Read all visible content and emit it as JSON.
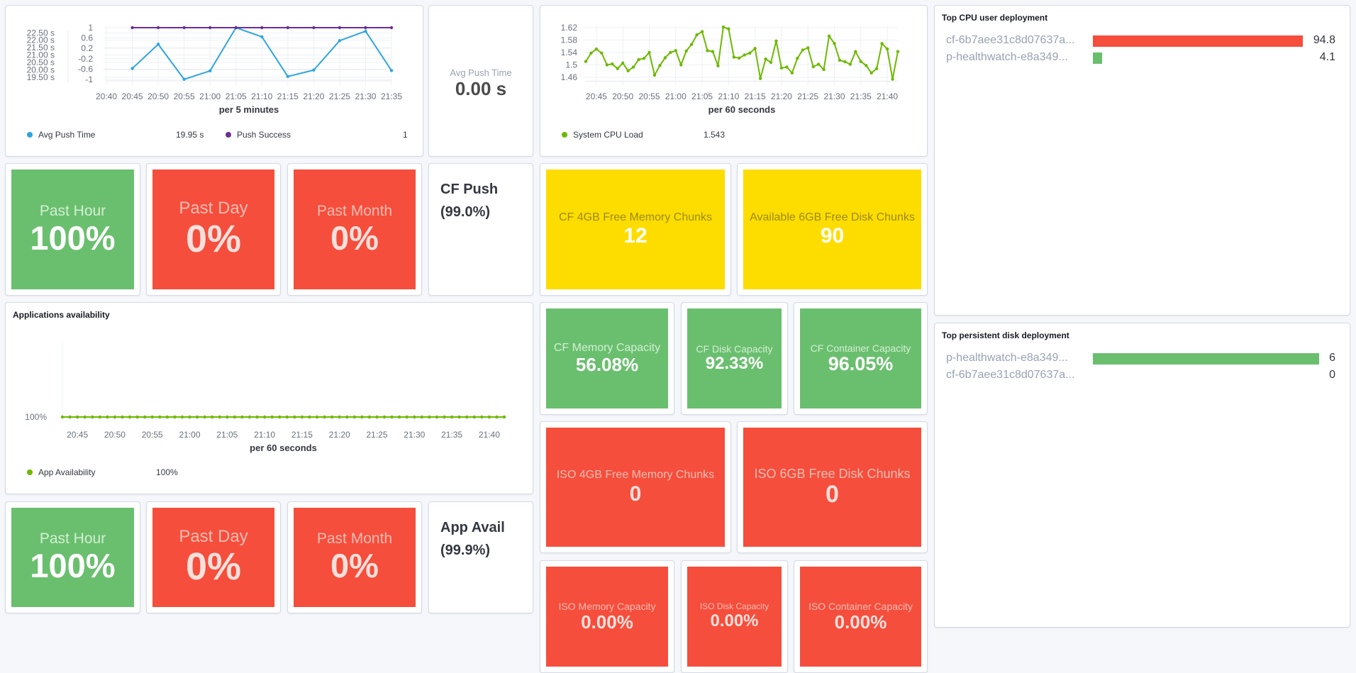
{
  "colors": {
    "green": "#6abf6f",
    "red": "#f54e3c",
    "yellow": "#fddd00",
    "blue": "#2fa4e0",
    "purple": "#6c2e96",
    "lime": "#6db900"
  },
  "push_legend": [
    {
      "label": "Avg Push Time",
      "value": "19.95 s"
    },
    {
      "label": "Push Success",
      "value": "1"
    }
  ],
  "avg_push": {
    "label": "Avg Push Time",
    "value": "0.00 s"
  },
  "cpu_legend": {
    "label": "System CPU Load",
    "value": "1.543"
  },
  "cf_push": {
    "tiles": [
      {
        "label": "Past Hour",
        "value": "100%",
        "status": "green"
      },
      {
        "label": "Past Day",
        "value": "0%",
        "status": "red"
      },
      {
        "label": "Past Month",
        "value": "0%",
        "status": "red"
      }
    ],
    "title": "CF Push",
    "value": "(99.0%)"
  },
  "chunks": [
    {
      "label": "CF 4GB Free Memory Chunks",
      "value": "12",
      "status": "yellow"
    },
    {
      "label": "Available 6GB Free Disk Chunks",
      "value": "90",
      "status": "yellow"
    }
  ],
  "app_availability": {
    "title": "Applications availability",
    "legend_label": "App Availability",
    "legend_value": "100%"
  },
  "cf_capacity": [
    {
      "label": "CF Memory Capacity",
      "value": "56.08%",
      "status": "green"
    },
    {
      "label": "CF Disk Capacity",
      "value": "92.33%",
      "status": "green"
    },
    {
      "label": "CF Container Capacity",
      "value": "96.05%",
      "status": "green"
    }
  ],
  "iso_chunks": [
    {
      "label": "ISO 4GB Free Memory Chunks",
      "value": "0",
      "status": "red"
    },
    {
      "label": "ISO 6GB Free Disk Chunks",
      "value": "0",
      "status": "red"
    }
  ],
  "iso_capacity": [
    {
      "label": "ISO Memory Capacity",
      "value": "0.00%",
      "status": "red"
    },
    {
      "label": "ISO Disk Capacity",
      "value": "0.00%",
      "status": "red"
    },
    {
      "label": "ISO Container Capacity",
      "value": "0.00%",
      "status": "red"
    }
  ],
  "app_avail": {
    "tiles": [
      {
        "label": "Past Hour",
        "value": "100%",
        "status": "green"
      },
      {
        "label": "Past Day",
        "value": "0%",
        "status": "red"
      },
      {
        "label": "Past Month",
        "value": "0%",
        "status": "red"
      }
    ],
    "title": "App Avail",
    "value": "(99.9%)"
  },
  "chart_data": [
    {
      "type": "line",
      "xlabel": "per 5 minutes",
      "x_range": [
        "20:40",
        "21:35"
      ],
      "x_ticks": [
        "20:40",
        "20:45",
        "20:50",
        "20:55",
        "21:00",
        "21:05",
        "21:10",
        "21:15",
        "21:20",
        "21:25",
        "21:30",
        "21:35"
      ],
      "grid": true,
      "y_axes": {
        "left": {
          "ticks": [
            22.5,
            22.0,
            21.5,
            21.0,
            20.5,
            20.0,
            19.5
          ],
          "tick_labels": [
            "22.50 s",
            "22.00 s",
            "21.50 s",
            "21.00 s",
            "20.50 s",
            "20.00 s",
            "19.50 s"
          ],
          "ylim": [
            19.35,
            22.85
          ]
        },
        "right": {
          "ticks": [
            1,
            0.6,
            0.2,
            -0.2,
            -0.6,
            -1
          ],
          "tick_labels": [
            "1",
            "0.6",
            "0.2",
            "-0.2",
            "-0.6",
            "-1"
          ],
          "ylim": [
            -1,
            1
          ]
        }
      },
      "x": [
        "20:45",
        "20:50",
        "20:55",
        "21:00",
        "21:05",
        "21:10",
        "21:15",
        "21:20",
        "21:25",
        "21:30",
        "21:35"
      ],
      "series": [
        {
          "name": "Avg Push Time",
          "axis": "left",
          "color": "#2fa4e0",
          "values": [
            20.09,
            21.73,
            19.36,
            19.93,
            22.85,
            22.23,
            19.55,
            19.98,
            21.97,
            22.61,
            19.95
          ]
        },
        {
          "name": "Push Success",
          "axis": "right",
          "color": "#6c2e96",
          "values": [
            1,
            1,
            1,
            1,
            1,
            1,
            1,
            1,
            1,
            1,
            1
          ]
        }
      ],
      "legend": "bottom"
    },
    {
      "type": "line",
      "xlabel": "per 60 seconds",
      "x_range": [
        "20:43",
        "21:42"
      ],
      "x_ticks": [
        "20:45",
        "20:50",
        "20:55",
        "21:00",
        "21:05",
        "21:10",
        "21:15",
        "21:20",
        "21:25",
        "21:30",
        "21:35",
        "21:40"
      ],
      "grid": true,
      "y_axes": {
        "left": {
          "ticks": [
            1.62,
            1.58,
            1.54,
            1.5,
            1.46
          ],
          "tick_labels": [
            "1.62",
            "1.58",
            "1.54",
            "1.5",
            "1.46"
          ],
          "ylim": [
            1.452,
            1.628
          ]
        }
      },
      "x_start": "20:43",
      "x_step_minutes": 1,
      "series": [
        {
          "name": "System CPU Load",
          "axis": "left",
          "color": "#6db900",
          "values": [
            1.511,
            1.538,
            1.551,
            1.538,
            1.5,
            1.503,
            1.488,
            1.506,
            1.481,
            1.493,
            1.517,
            1.521,
            1.54,
            1.467,
            1.498,
            1.523,
            1.54,
            1.546,
            1.5,
            1.545,
            1.566,
            1.597,
            1.607,
            1.546,
            1.543,
            1.497,
            1.622,
            1.616,
            1.525,
            1.522,
            1.532,
            1.538,
            1.553,
            1.456,
            1.519,
            1.508,
            1.577,
            1.49,
            1.493,
            1.474,
            1.521,
            1.548,
            1.555,
            1.494,
            1.502,
            1.485,
            1.593,
            1.569,
            1.515,
            1.51,
            1.502,
            1.543,
            1.511,
            1.498,
            1.474,
            1.488,
            1.569,
            1.551,
            1.454,
            1.543
          ]
        }
      ],
      "legend": "bottom"
    },
    {
      "type": "line",
      "xlabel": "per 60 seconds",
      "x_range": [
        "20:43",
        "21:42"
      ],
      "x_ticks": [
        "20:45",
        "20:50",
        "20:55",
        "21:00",
        "21:05",
        "21:10",
        "21:15",
        "21:20",
        "21:25",
        "21:30",
        "21:35",
        "21:40"
      ],
      "grid": false,
      "y_axes": {
        "left": {
          "ticks": [
            100
          ],
          "tick_labels": [
            "100%"
          ],
          "ylim": [
            100,
            101
          ]
        }
      },
      "x_start": "20:43",
      "x_step_minutes": 1,
      "series": [
        {
          "name": "App Availability",
          "axis": "left",
          "color": "#6db900",
          "values": [
            100,
            100,
            100,
            100,
            100,
            100,
            100,
            100,
            100,
            100,
            100,
            100,
            100,
            100,
            100,
            100,
            100,
            100,
            100,
            100,
            100,
            100,
            100,
            100,
            100,
            100,
            100,
            100,
            100,
            100,
            100,
            100,
            100,
            100,
            100,
            100,
            100,
            100,
            100,
            100,
            100,
            100,
            100,
            100,
            100,
            100,
            100,
            100,
            100,
            100,
            100,
            100,
            100,
            100,
            100,
            100,
            100,
            100,
            100,
            100
          ]
        }
      ],
      "legend": "bottom"
    },
    {
      "type": "bar",
      "orientation": "horizontal",
      "title": "Top CPU user deployment",
      "categories": [
        "cf-6b7aee31c8d07637a...",
        "p-healthwatch-e8a349..."
      ],
      "values": [
        94.8,
        4.1
      ],
      "value_labels": [
        "94.8",
        "4.1"
      ],
      "colors": [
        "#f54e3c",
        "#6abf6f"
      ]
    },
    {
      "type": "bar",
      "orientation": "horizontal",
      "title": "Top persistent disk deployment",
      "categories": [
        "p-healthwatch-e8a349...",
        "cf-6b7aee31c8d07637a..."
      ],
      "values": [
        6,
        0
      ],
      "value_labels": [
        "6",
        "0"
      ],
      "colors": [
        "#6abf6f",
        "#6abf6f"
      ]
    }
  ]
}
